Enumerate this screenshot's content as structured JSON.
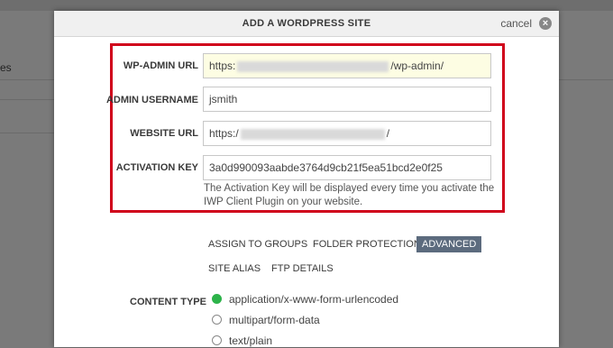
{
  "background": {
    "partial_text": "es"
  },
  "modal": {
    "title": "ADD A WORDPRESS SITE",
    "cancel_label": "cancel",
    "cancel_icon": "x-circle-icon"
  },
  "form": {
    "wp_admin_url": {
      "label": "WP-ADMIN URL",
      "prefix": "https:",
      "suffix": "/wp-admin/"
    },
    "admin_username": {
      "label": "ADMIN USERNAME",
      "value": "jsmith"
    },
    "website_url": {
      "label": "WEBSITE URL",
      "prefix": "https:/",
      "suffix": "/"
    },
    "activation_key": {
      "label": "ACTIVATION KEY",
      "value": "3a0d990093aabde3764d9cb21f5ea51bcd2e0f25",
      "hint": "The Activation Key will be displayed every time you activate the IWP Client Plugin on your website."
    }
  },
  "tabs": {
    "assign_to_groups": "ASSIGN TO GROUPS",
    "folder_protection": "FOLDER PROTECTION",
    "advanced": "ADVANCED",
    "site_alias": "SITE ALIAS",
    "ftp_details": "FTP DETAILS"
  },
  "content_type": {
    "label": "CONTENT TYPE",
    "options": [
      {
        "label": "application/x-www-form-urlencoded",
        "selected": true
      },
      {
        "label": "multipart/form-data",
        "selected": false
      },
      {
        "label": "text/plain",
        "selected": false
      }
    ]
  },
  "colors": {
    "highlight": "#d0021b",
    "active_tab": "#5c6b7e",
    "radio_selected": "#2db34a"
  }
}
